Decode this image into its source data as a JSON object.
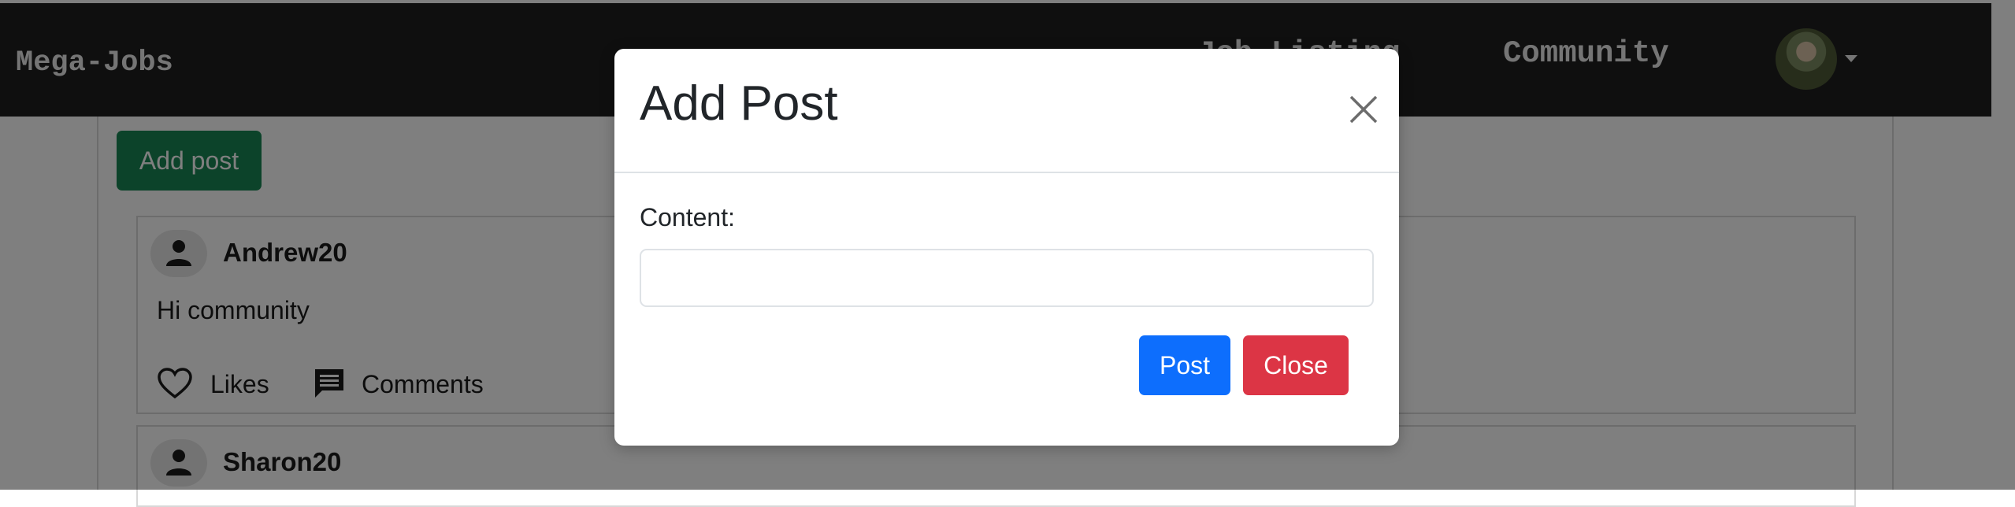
{
  "navbar": {
    "brand": "Mega-Jobs",
    "links": [
      "Job Listing",
      "Community"
    ],
    "avatar_icon": "user-avatar-photo"
  },
  "main": {
    "add_post_label": "Add post",
    "posts": [
      {
        "username": "Andrew20",
        "content": "Hi community",
        "likes_label": "Likes",
        "comments_label": "Comments"
      },
      {
        "username": "Sharon20"
      }
    ]
  },
  "modal": {
    "title": "Add Post",
    "content_label": "Content:",
    "content_value": "",
    "post_label": "Post",
    "close_label": "Close"
  },
  "colors": {
    "navbar": "#1f1f1f",
    "success": "#198754",
    "primary": "#0d6efd",
    "danger": "#dc3545"
  }
}
